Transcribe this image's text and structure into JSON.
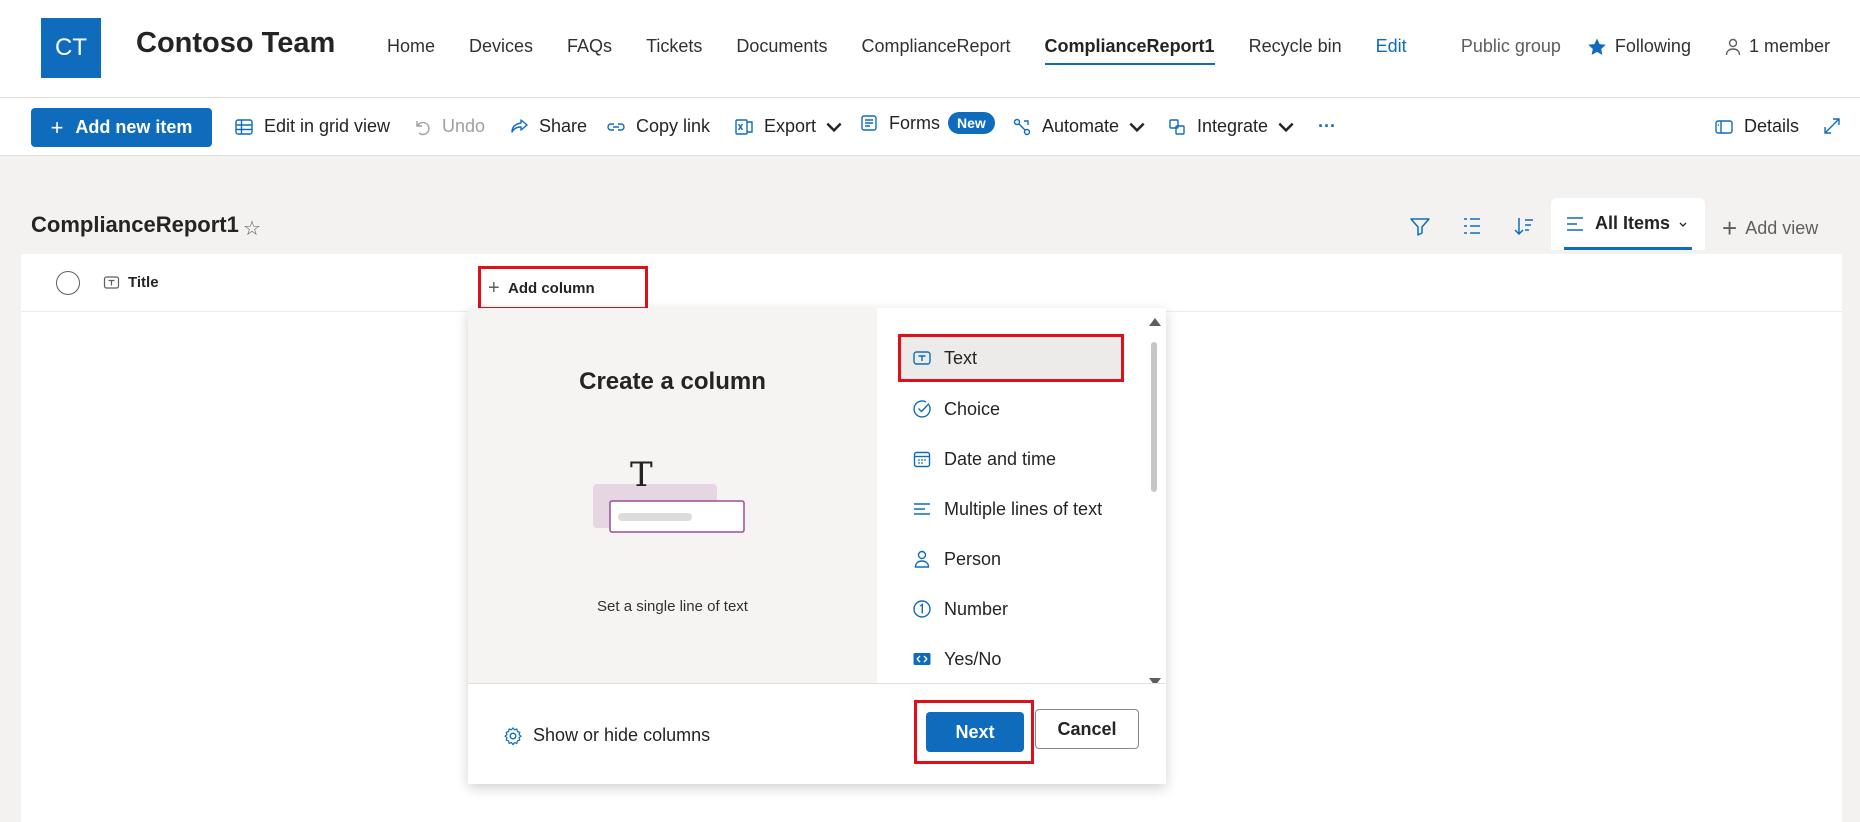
{
  "site": {
    "logo_initials": "CT",
    "title": "Contoso Team",
    "nav": [
      "Home",
      "Devices",
      "FAQs",
      "Tickets",
      "Documents",
      "ComplianceReport",
      "ComplianceReport1",
      "Recycle bin",
      "Edit"
    ],
    "active_nav": "ComplianceReport1",
    "public_label": "Public group",
    "following_label": "Following",
    "members_label": "1 member"
  },
  "commandbar": {
    "add_new_item": "Add new item",
    "edit_grid": "Edit in grid view",
    "undo": "Undo",
    "share": "Share",
    "copy_link": "Copy link",
    "export": "Export",
    "forms": "Forms",
    "forms_badge": "New",
    "automate": "Automate",
    "integrate": "Integrate",
    "more": "···",
    "details": "Details"
  },
  "list": {
    "title": "ComplianceReport1",
    "current_view": "All Items",
    "add_view": "Add view",
    "title_column": "Title",
    "add_column": "Add column"
  },
  "create_column": {
    "heading": "Create a column",
    "illustration_glyph": "T",
    "description": "Set a single line of text",
    "types": [
      "Text",
      "Choice",
      "Date and time",
      "Multiple lines of text",
      "Person",
      "Number",
      "Yes/No"
    ],
    "selected_type": "Text",
    "show_hide": "Show or hide columns",
    "next": "Next",
    "cancel": "Cancel"
  },
  "colors": {
    "accent": "#0f6cbd",
    "highlight": "#e0101a"
  }
}
